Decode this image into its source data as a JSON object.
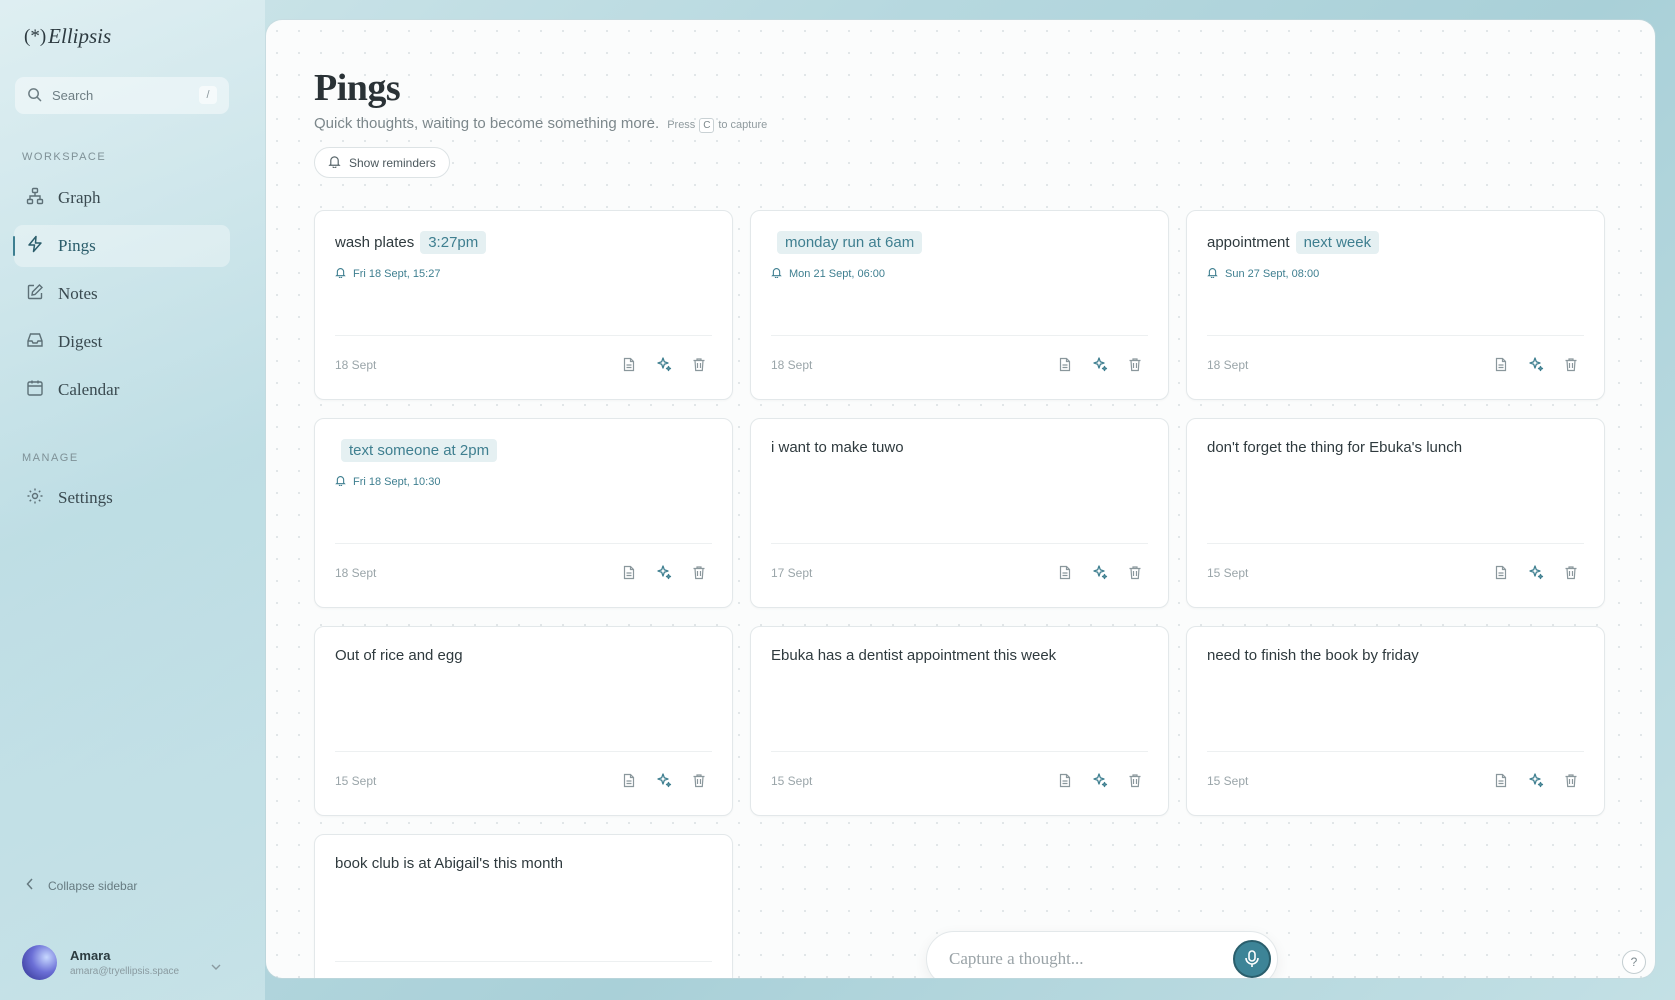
{
  "app": {
    "logo_mark": "(*)",
    "logo_text": "Ellipsis"
  },
  "sidebar": {
    "search_placeholder": "Search",
    "search_shortcut": "/",
    "workspace_label": "WORKSPACE",
    "manage_label": "MANAGE",
    "items": [
      {
        "label": "Graph",
        "icon": "graph-icon"
      },
      {
        "label": "Pings",
        "icon": "lightning-icon",
        "active": true
      },
      {
        "label": "Notes",
        "icon": "edit-icon"
      },
      {
        "label": "Digest",
        "icon": "inbox-icon"
      },
      {
        "label": "Calendar",
        "icon": "calendar-icon"
      }
    ],
    "settings_label": "Settings",
    "collapse_label": "Collapse sidebar",
    "user": {
      "name": "Amara",
      "email": "amara@tryellipsis.space"
    }
  },
  "main": {
    "title": "Pings",
    "subtitle": "Quick thoughts, waiting to become something more.",
    "hint_press": "Press",
    "hint_key": "C",
    "hint_to": "to capture",
    "reminders_button": "Show reminders",
    "capture_placeholder": "Capture a thought...",
    "help_label": "?"
  },
  "cards": [
    {
      "text": "wash plates",
      "tag": "3:27pm",
      "reminder": "Fri 18 Sept, 15:27",
      "date": "18 Sept"
    },
    {
      "text": "",
      "tag": "monday run at 6am",
      "reminder": "Mon 21 Sept, 06:00",
      "date": "18 Sept"
    },
    {
      "text": "appointment",
      "tag": "next week",
      "reminder": "Sun 27 Sept, 08:00",
      "date": "18 Sept"
    },
    {
      "text": "",
      "tag": "text someone at 2pm",
      "reminder": "Fri 18 Sept, 10:30",
      "date": "18 Sept"
    },
    {
      "text": "i want to make tuwo",
      "tag": "",
      "reminder": "",
      "date": "17 Sept"
    },
    {
      "text": "don't forget the thing for Ebuka's lunch",
      "tag": "",
      "reminder": "",
      "date": "15 Sept"
    },
    {
      "text": "Out of rice and egg",
      "tag": "",
      "reminder": "",
      "date": "15 Sept"
    },
    {
      "text": "Ebuka has a dentist appointment this week",
      "tag": "",
      "reminder": "",
      "date": "15 Sept"
    },
    {
      "text": "need to finish the book by friday",
      "tag": "",
      "reminder": "",
      "date": "15 Sept"
    },
    {
      "text": "book club is at Abigail's this month",
      "tag": "",
      "reminder": "",
      "date": ""
    }
  ],
  "colors": {
    "accent": "#3f7f90",
    "tag_bg": "#e5f0f2",
    "mic": "#3d8497"
  }
}
